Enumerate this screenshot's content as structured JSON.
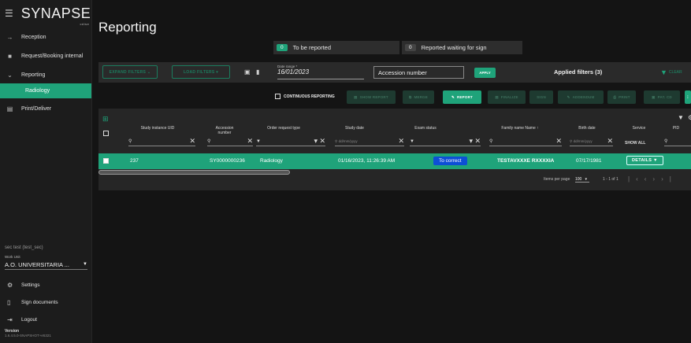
{
  "sidebar": {
    "brand": "SYNAPSE",
    "brand_sub": "cdise",
    "items": [
      {
        "label": "Reception"
      },
      {
        "label": "Request/Booking internal"
      },
      {
        "label": "Reporting"
      },
      {
        "label": "Radiology"
      },
      {
        "label": "Print/Deliver"
      }
    ],
    "user": "sec test (test_sec)",
    "work_unit_label": "Work Unit",
    "work_unit_value": "A.O. UNIVERSITARIA ...",
    "settings": "Settings",
    "sign_documents": "Sign documents",
    "logout": "Logout",
    "version_label": "Version",
    "version_value": "1.6.4.5.0-SNAPSHOT+e5321"
  },
  "page": {
    "title": "Reporting",
    "counter1_num": "0",
    "counter1_label": "To be reported",
    "counter2_num": "0",
    "counter2_label": "Reported waiting for sign"
  },
  "filters": {
    "expand": "EXPAND FILTERS",
    "load": "LOAD FILTERS",
    "date_label": "Date range *",
    "date_value": "16/01/2023",
    "accession_placeholder": "Accession number",
    "apply": "APPLY",
    "applied": "Applied filters (3)",
    "clear": "CLEAR"
  },
  "actions": {
    "continuous": "CONTINUOUS REPORTING",
    "show_report": "SHOW REPORT",
    "merge": "MERGE",
    "report": "REPORT",
    "finalize": "FINALIZE",
    "sign": "SIGN",
    "addendum": "ADDENDUM",
    "print": "PRINT",
    "pat_cd": "PAT. CD"
  },
  "table": {
    "columns": [
      "Study instance UID",
      "Accession number",
      "Order request type",
      "Study date",
      "Exam status",
      "Family name Name ↑",
      "Birth date",
      "Service",
      "PID"
    ],
    "date_placeholder": "dd/mm/yyyy",
    "show_all": "SHOW ALL",
    "row": {
      "uid": "237",
      "accession": "SY0000000236",
      "order_type": "Radiology",
      "study_date": "01/16/2023, 11:26:39 AM",
      "status": "To correct",
      "name": "TESTAVXXXE RXXXXIA",
      "birth": "07/17/1981",
      "details": "DETAILS"
    },
    "items_per_page_label": "Items per page",
    "items_per_page": "100",
    "range": "1 - 1 of 1"
  }
}
